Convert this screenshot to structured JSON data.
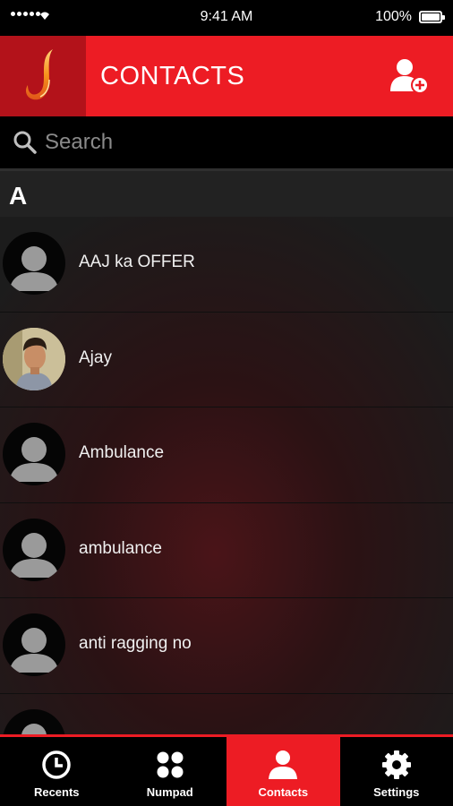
{
  "status_bar": {
    "time": "9:41 AM",
    "battery": "100%"
  },
  "header": {
    "title": "CONTACTS"
  },
  "search": {
    "placeholder": "Search"
  },
  "section": {
    "letter": "A"
  },
  "contacts": [
    {
      "name": "AAJ ka OFFER",
      "avatar": "default"
    },
    {
      "name": "Ajay",
      "avatar": "photo"
    },
    {
      "name": "Ambulance",
      "avatar": "default"
    },
    {
      "name": "ambulance",
      "avatar": "default"
    },
    {
      "name": "anti ragging no",
      "avatar": "default"
    },
    {
      "name": "",
      "avatar": "default"
    }
  ],
  "tabs": [
    {
      "label": "Recents",
      "icon": "clock-icon"
    },
    {
      "label": "Numpad",
      "icon": "numpad-icon"
    },
    {
      "label": "Contacts",
      "icon": "person-icon",
      "active": true
    },
    {
      "label": "Settings",
      "icon": "gear-icon"
    }
  ],
  "colors": {
    "accent": "#ed1c24",
    "logo_bg": "#b3121a",
    "background": "#1c1c1c"
  }
}
